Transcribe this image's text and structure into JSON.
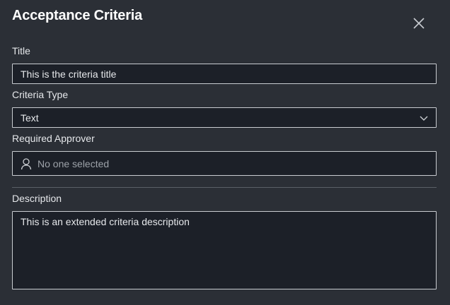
{
  "dialog": {
    "title": "Acceptance Criteria",
    "close_icon": "close-icon"
  },
  "fields": {
    "title": {
      "label": "Title",
      "value": "This is the criteria title"
    },
    "criteria_type": {
      "label": "Criteria Type",
      "selected": "Text",
      "icon": "chevron-down-icon"
    },
    "required_approver": {
      "label": "Required Approver",
      "placeholder": "No one selected",
      "icon": "person-icon"
    },
    "description": {
      "label": "Description",
      "value": "This is an extended criteria description"
    }
  },
  "colors": {
    "background": "#2b2f36",
    "input_background": "#1c2028",
    "input_border": "#c9ccd1",
    "text": "#e6e8eb",
    "placeholder": "#9da2a9"
  }
}
